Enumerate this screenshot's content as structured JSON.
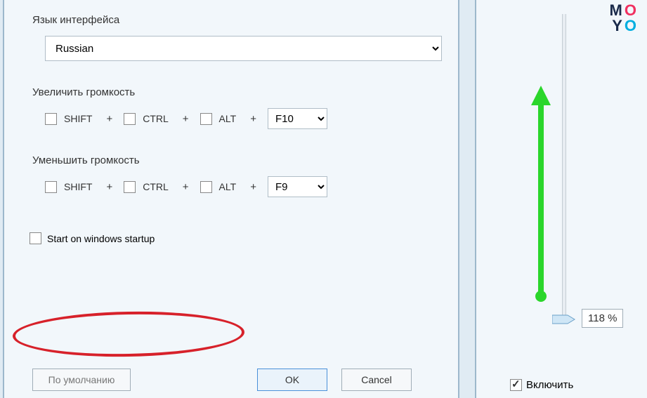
{
  "settings": {
    "language_label": "Язык интерфейса",
    "language_value": "Russian",
    "increase_label": "Увеличить громкость",
    "decrease_label": "Уменьшить громкость",
    "shift": "SHIFT",
    "ctrl": "CTRL",
    "alt": "ALT",
    "plus": "+",
    "increase_key": "F10",
    "decrease_key": "F9",
    "startup_label": "Start on windows startup"
  },
  "buttons": {
    "default": "По умолчанию",
    "ok": "OK",
    "cancel": "Cancel"
  },
  "side": {
    "percent": "118 %",
    "enable": "Включить"
  },
  "logo": {
    "m": "M",
    "o1": "O",
    "y": "Y",
    "o2": "O"
  }
}
